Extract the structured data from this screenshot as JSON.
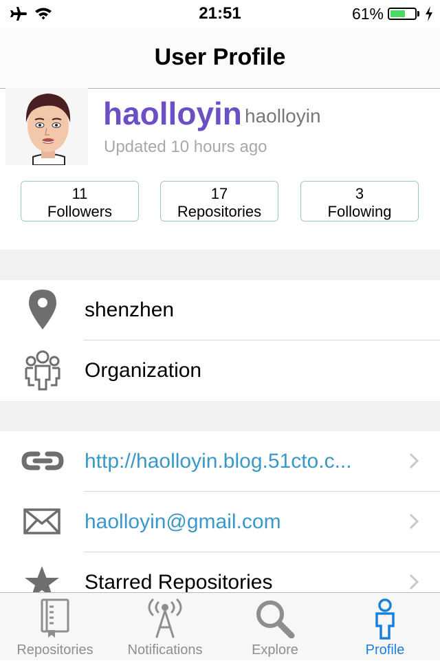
{
  "status_bar": {
    "time": "21:51",
    "battery": "61%",
    "battery_level": 0.61
  },
  "nav": {
    "title": "User Profile"
  },
  "profile": {
    "name": "haolloyin",
    "login": "haolloyin",
    "updated": "Updated 10 hours ago"
  },
  "stats": [
    {
      "count": "11",
      "label": "Followers"
    },
    {
      "count": "17",
      "label": "Repositories"
    },
    {
      "count": "3",
      "label": "Following"
    }
  ],
  "info": {
    "location": "shenzhen",
    "organization": "Organization"
  },
  "links": {
    "blog": "http://haolloyin.blog.51cto.c...",
    "email": "haolloyin@gmail.com",
    "starred": "Starred Repositories"
  },
  "tabs": [
    {
      "label": "Repositories",
      "icon": "book-icon"
    },
    {
      "label": "Notifications",
      "icon": "antenna-icon"
    },
    {
      "label": "Explore",
      "icon": "search-icon"
    },
    {
      "label": "Profile",
      "icon": "person-icon",
      "active": true
    }
  ],
  "colors": {
    "accent": "#1c7fda",
    "name": "#6c4fc4",
    "link": "#3a98c8"
  }
}
